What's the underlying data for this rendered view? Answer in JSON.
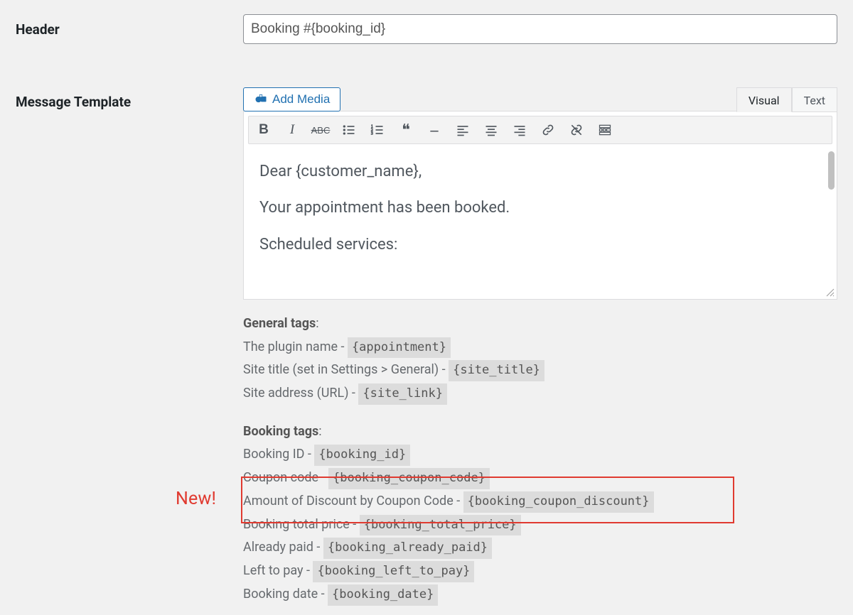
{
  "form": {
    "header": {
      "label": "Header",
      "value": "Booking #{booking_id}"
    },
    "message_template": {
      "label": "Message Template"
    }
  },
  "editor": {
    "add_media_label": "Add Media",
    "tabs": {
      "visual": "Visual",
      "text": "Text"
    },
    "content": {
      "line1": "Dear {customer_name},",
      "line2": "Your appointment has been booked.",
      "line3": "Scheduled services:"
    },
    "toolbar": {
      "bold": "B",
      "italic": "I",
      "strike": "ABC"
    }
  },
  "tags": {
    "general": {
      "title": "General tags",
      "rows": [
        {
          "label": "The plugin name - ",
          "tag": "{appointment}"
        },
        {
          "label": "Site title (set in Settings > General) - ",
          "tag": "{site_title}"
        },
        {
          "label": "Site address (URL) - ",
          "tag": "{site_link}"
        }
      ]
    },
    "booking": {
      "title": "Booking tags",
      "rows": [
        {
          "label": "Booking ID - ",
          "tag": "{booking_id}"
        },
        {
          "label": "Coupon code - ",
          "tag": "{booking_coupon_code}"
        },
        {
          "label": "Amount of Discount by Coupon Code - ",
          "tag": "{booking_coupon_discount}"
        },
        {
          "label": "Booking total price - ",
          "tag": "{booking_total_price}"
        },
        {
          "label": "Already paid - ",
          "tag": "{booking_already_paid}"
        },
        {
          "label": "Left to pay - ",
          "tag": "{booking_left_to_pay}"
        },
        {
          "label": "Booking date - ",
          "tag": "{booking_date}"
        }
      ]
    }
  },
  "callout": {
    "new_label": "New!"
  }
}
